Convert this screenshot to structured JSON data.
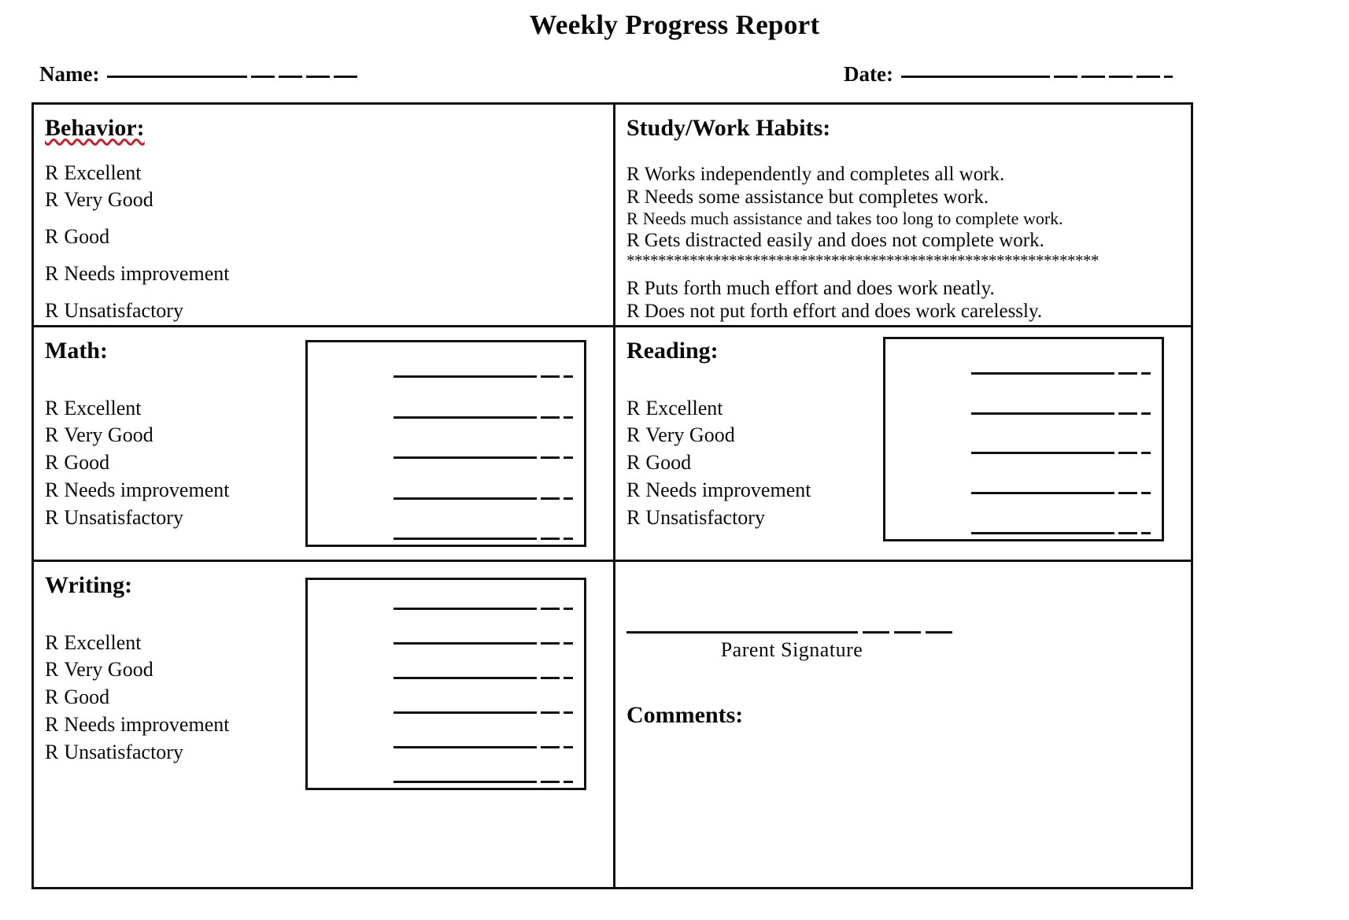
{
  "document": {
    "title": "Weekly Progress Report"
  },
  "header": {
    "name_label": "Name:",
    "date_label": "Date:"
  },
  "rating_mark": "R",
  "sections": {
    "behavior": {
      "title": "Behavior:",
      "options": [
        "Excellent",
        "Very Good",
        "Good",
        "Needs improvement",
        "Unsatisfactory"
      ]
    },
    "study_work_habits": {
      "title": "Study/Work Habits:",
      "options_group_one": [
        "Works independently and completes all work.",
        "Needs some assistance but completes work.",
        "Needs much assistance and takes too long to complete work.",
        "Gets distracted easily and does not complete work."
      ],
      "separator": "************************************************************",
      "options_group_two": [
        "Puts forth much effort and does work neatly.",
        "Does not put forth effort and does work carelessly."
      ]
    },
    "math": {
      "title": "Math:",
      "options": [
        "Excellent",
        "Very Good",
        "Good",
        "Needs improvement",
        "Unsatisfactory"
      ],
      "note_lines": 5
    },
    "reading": {
      "title": "Reading:",
      "options": [
        "Excellent",
        "Very Good",
        "Good",
        "Needs improvement",
        "Unsatisfactory"
      ],
      "note_lines": 5
    },
    "writing": {
      "title": "Writing:",
      "options": [
        "Excellent",
        "Very Good",
        "Good",
        "Needs improvement",
        "Unsatisfactory"
      ],
      "note_lines": 6
    },
    "signature": {
      "caption": "Parent Signature",
      "comments_label": "Comments:"
    }
  },
  "colors": {
    "ink": "#0a0a0a",
    "rule": "#111111",
    "spellcheck_underline": "#c0242c",
    "paper": "#ffffff"
  }
}
